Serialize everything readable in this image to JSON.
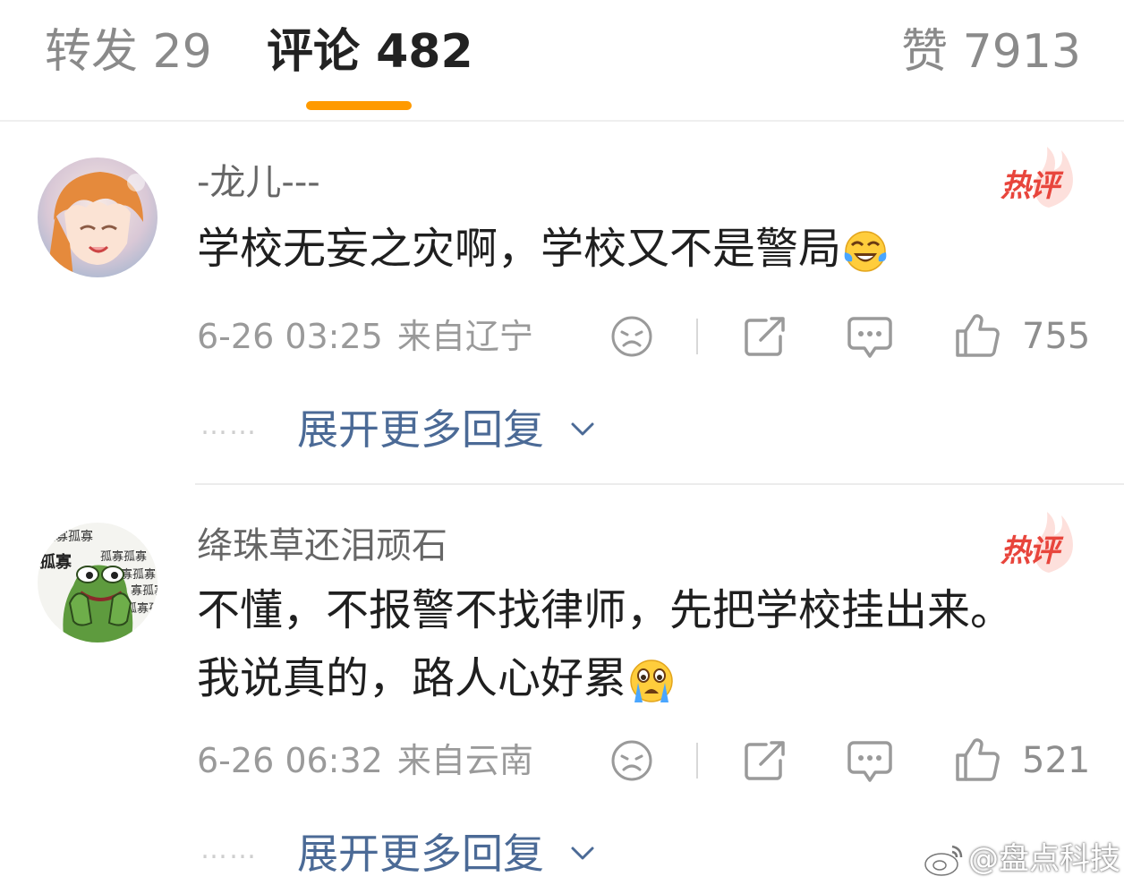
{
  "tabs": {
    "forward": "转发 29",
    "comments": "评论 482",
    "likes": "赞 7913"
  },
  "comments": [
    {
      "username": "-龙儿---",
      "badge": "热评",
      "text_line1": "学校无妄之灾啊，学校又不是警局",
      "emoji": "crying-laughing-emoji",
      "time": "6-26 03:25",
      "location": "来自辽宁",
      "like_count": "755",
      "more_replies": "展开更多回复",
      "dots": "……"
    },
    {
      "username": "绛珠草还泪顽石",
      "badge": "热评",
      "text_line1": "不懂，不报警不找律师，先把学校挂出来。",
      "text_line2": "我说真的，路人心好累",
      "emoji": "crying-emoji",
      "avatar_text": "孤寡孤寡",
      "time": "6-26 06:32",
      "location": "来自云南",
      "like_count": "521",
      "more_replies": "展开更多回复",
      "dots": "……"
    }
  ],
  "watermark": "@盘点科技",
  "colors": {
    "tab_underline": "#ff9a00",
    "hot_badge": "#e8453c",
    "link": "#4b6a96",
    "meta": "#9a9a9a"
  }
}
